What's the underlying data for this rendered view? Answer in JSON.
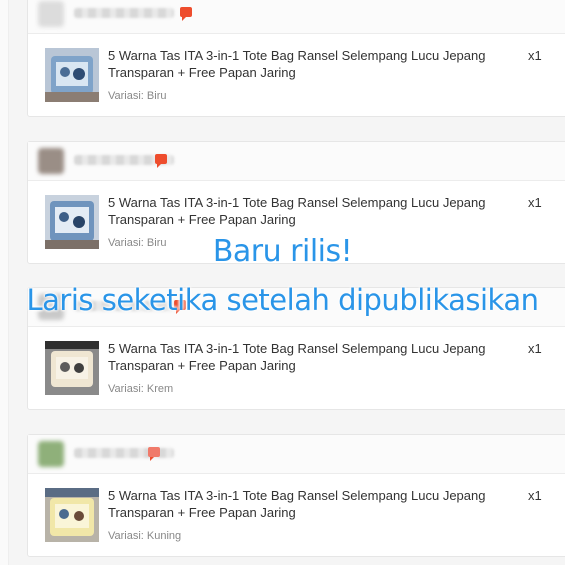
{
  "orders": [
    {
      "item_name": "5 Warna Tas ITA 3-in-1 Tote Bag Ransel Selempang Lucu Jepang Transparan + Free Papan Jaring",
      "quantity": "x1",
      "variant": "Variasi: Biru"
    },
    {
      "item_name": "5 Warna Tas ITA 3-in-1 Tote Bag Ransel Selempang Lucu Jepang Transparan + Free Papan Jaring",
      "quantity": "x1",
      "variant": "Variasi: Biru"
    },
    {
      "item_name": "5 Warna Tas ITA 3-in-1 Tote Bag Ransel Selempang Lucu Jepang Transparan + Free Papan Jaring",
      "quantity": "x1",
      "variant": "Variasi: Krem"
    },
    {
      "item_name": "5 Warna Tas ITA 3-in-1 Tote Bag Ransel Selempang Lucu Jepang Transparan + Free Papan Jaring",
      "quantity": "x1",
      "variant": "Variasi: Kuning"
    }
  ],
  "promo": {
    "line1": "Baru rilis!",
    "line2": "Laris seketika setelah dipublikasikan"
  },
  "colors": {
    "accent": "#ee4d2d",
    "overlay_text": "#2a95e8"
  },
  "icons": {
    "chat": "chat-icon"
  }
}
